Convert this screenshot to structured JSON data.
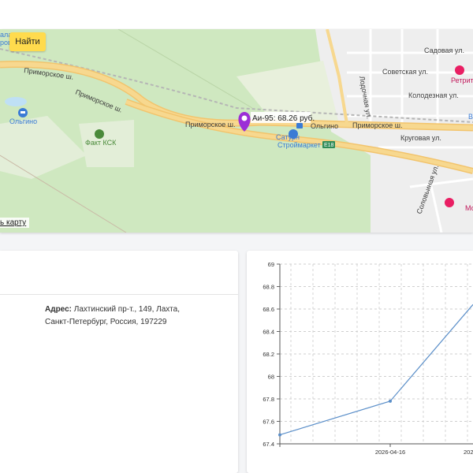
{
  "map": {
    "find_button": "Найти",
    "open_map_link": "ь карту",
    "marker": {
      "label": "Аи-95: 68.26 руб."
    },
    "labels": {
      "primorskoe1": "Приморское ш.",
      "primorskoe2": "Приморское ш.",
      "primorskoe3": "Приморское ш.",
      "primorskoe4": "Приморское ш.",
      "olgino_left": "Ольгино",
      "olgino_station": "Ольгино",
      "fakt_ksk": "Факт КСК",
      "saturn1": "Сатурн",
      "saturn2": "Строймаркет",
      "e18": "E18",
      "retrit": "Ретрит",
      "sadovaya": "Садовая ул.",
      "sovetskaya": "Советская ул.",
      "kolodeznaya": "Колодезная ул.",
      "krugovaya": "Круговая ул.",
      "solovinaya": "Соловьиная ул.",
      "lodocnaya": "Лодочная ул.",
      "partial_top": "ала",
      "partial_top2": "ровки",
      "partial_right": "Мо",
      "partial_right2": "В"
    },
    "colors": {
      "road": "#f7d88f",
      "water": "#bfe0f5",
      "forest": "#cfe8c0",
      "urban": "#eeeeee",
      "marker": "#9b2fd6"
    }
  },
  "info": {
    "address_label": "Адрес:",
    "address_value": "Лахтинский пр-т., 149, Лахта, Санкт-Петербург, Россия, 197229"
  },
  "chart_data": {
    "type": "line",
    "title": "",
    "xlabel": "",
    "ylabel": "",
    "ylim": [
      67.4,
      69
    ],
    "y_ticks": [
      "67.4",
      "67.6",
      "67.8",
      "68",
      "68.2",
      "68.4",
      "68.6",
      "68.8",
      "69"
    ],
    "x_ticks": [
      "2026-04-16",
      "2026-0"
    ],
    "series": [
      {
        "x": [
          "",
          "2026-04-16",
          ""
        ],
        "values": [
          67.48,
          67.78,
          68.64
        ]
      }
    ],
    "grid": true,
    "line_color": "#5b8fc9"
  }
}
